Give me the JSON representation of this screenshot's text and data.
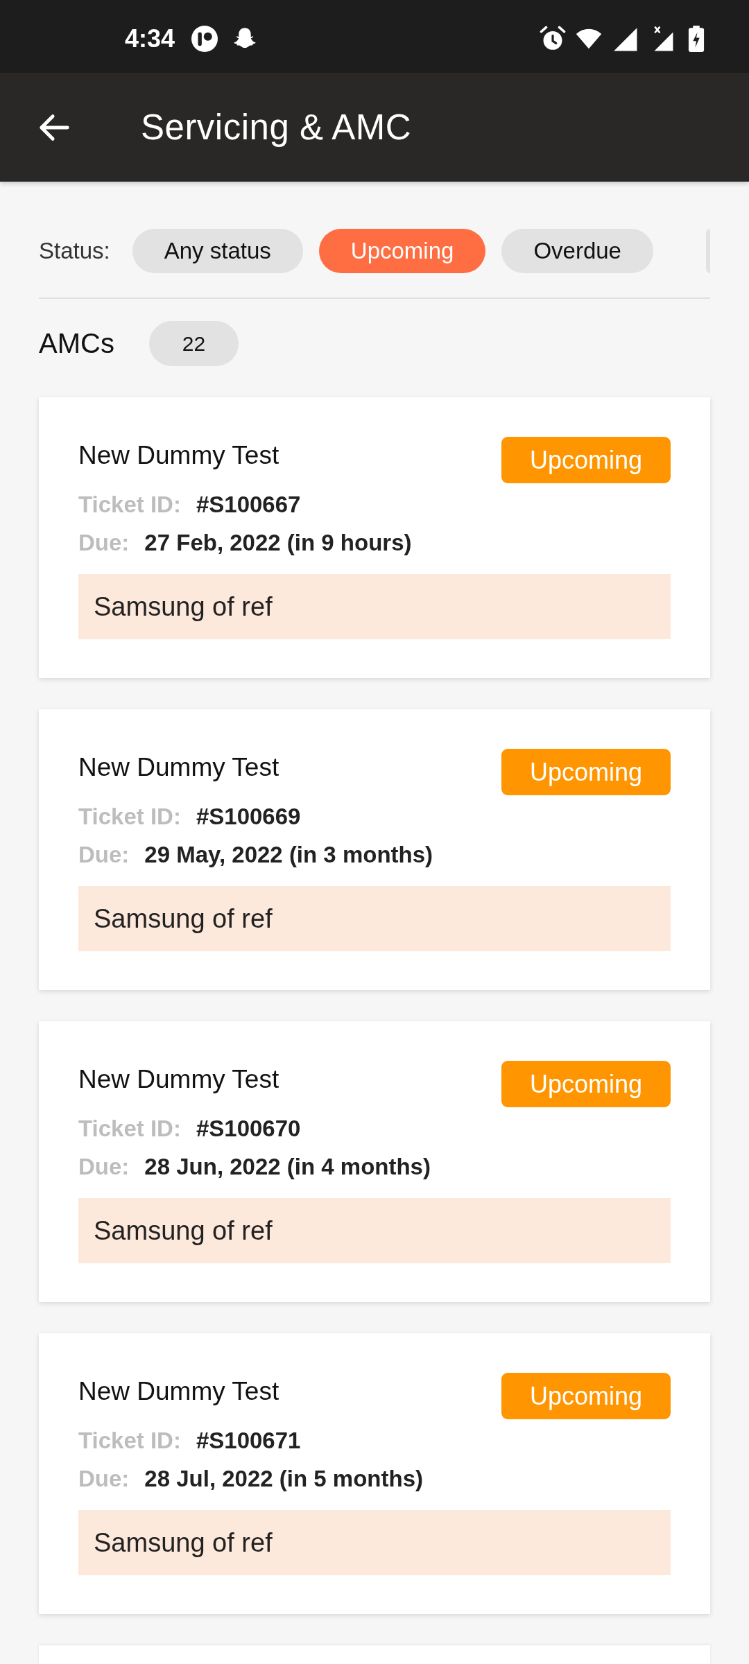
{
  "status_bar": {
    "time": "4:34"
  },
  "app_bar": {
    "title": "Servicing & AMC"
  },
  "filter": {
    "label": "Status:",
    "chips": [
      {
        "label": "Any status",
        "selected": false
      },
      {
        "label": "Upcoming",
        "selected": true
      },
      {
        "label": "Overdue",
        "selected": false
      }
    ]
  },
  "section": {
    "title": "AMCs",
    "count": "22"
  },
  "cards": [
    {
      "title": "New Dummy Test",
      "badge": {
        "label": "Upcoming",
        "color": "#ff9500"
      },
      "ticket_label": "Ticket ID:",
      "ticket_id": "#S100667",
      "due_label": "Due:",
      "due": "27 Feb, 2022 (in 9 hours)",
      "note": "Samsung of ref"
    },
    {
      "title": "New Dummy Test",
      "badge": {
        "label": "Upcoming",
        "color": "#ff9500"
      },
      "ticket_label": "Ticket ID:",
      "ticket_id": "#S100669",
      "due_label": "Due:",
      "due": "29 May, 2022 (in 3 months)",
      "note": "Samsung of ref"
    },
    {
      "title": "New Dummy Test",
      "badge": {
        "label": "Upcoming",
        "color": "#ff9500"
      },
      "ticket_label": "Ticket ID:",
      "ticket_id": "#S100670",
      "due_label": "Due:",
      "due": "28 Jun, 2022 (in 4 months)",
      "note": "Samsung of ref"
    },
    {
      "title": "New Dummy Test",
      "badge": {
        "label": "Upcoming",
        "color": "#ff9500"
      },
      "ticket_label": "Ticket ID:",
      "ticket_id": "#S100671",
      "due_label": "Due:",
      "due": "28 Jul, 2022 (in 5 months)",
      "note": "Samsung of ref"
    }
  ]
}
